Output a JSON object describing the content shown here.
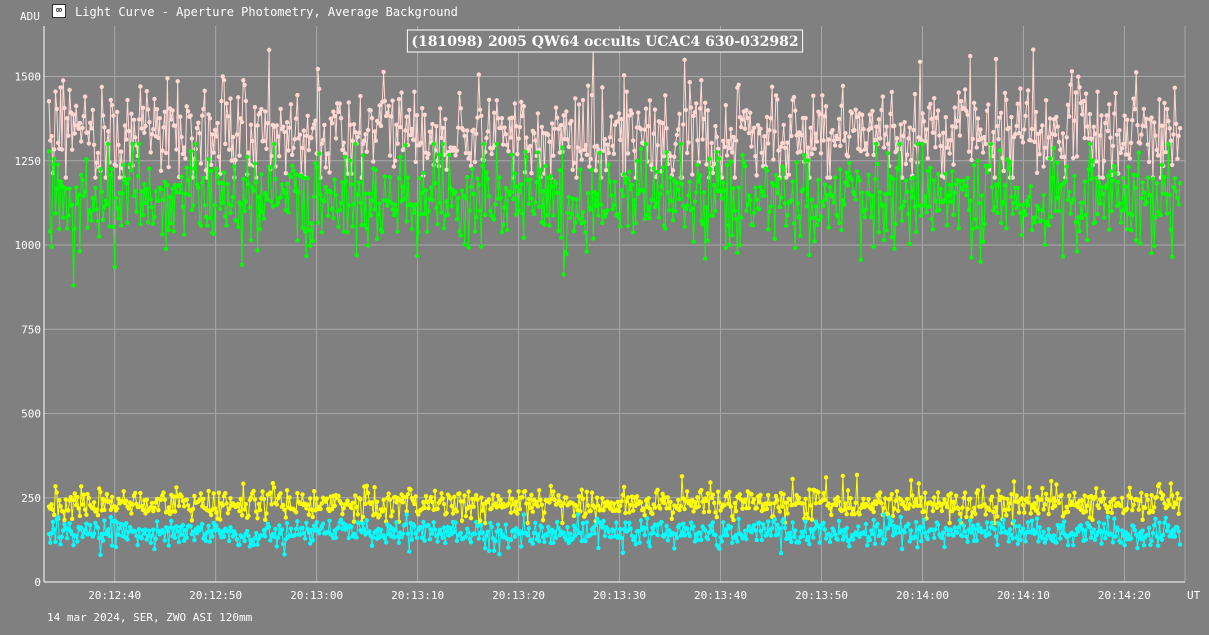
{
  "window": {
    "title": "Light Curve - Aperture Photometry, Average Background",
    "icon": "light-curve-app-icon"
  },
  "footer": {
    "text": "14 mar 2024, SER, ZWO ASI 120mm"
  },
  "colors": {
    "background": "#808080",
    "grid": "#a8a8a8",
    "target": "#00ff00",
    "comparison": "#ffd8d4",
    "background_target": "#ffff00",
    "background_comparison": "#00ffff"
  },
  "chart_data": {
    "type": "scatter",
    "title": "(181098) 2005 QW64 occults UCAC4 630-032982",
    "xlabel": "UT",
    "ylabel": "ADU",
    "xlim": [
      "20:12:33",
      "20:14:26"
    ],
    "ylim": [
      0,
      1650
    ],
    "yticks": [
      0,
      250,
      500,
      750,
      1000,
      1250,
      1500
    ],
    "ytick_labels": [
      "0",
      "250",
      "500",
      "750",
      "1000",
      "1250",
      "1500"
    ],
    "xticks": [
      "20:12:40",
      "20:12:50",
      "20:13:00",
      "20:13:10",
      "20:13:20",
      "20:13:30",
      "20:13:40",
      "20:13:50",
      "20:14:00",
      "20:14:10",
      "20:14:20"
    ],
    "grid": true,
    "connected_markers": true,
    "series": [
      {
        "color": "#ffd8d4",
        "mean": 1330,
        "spread": 75,
        "min": 1200,
        "max": 1580
      },
      {
        "color": "#00ff00",
        "mean": 1130,
        "spread": 70,
        "min": 880,
        "max": 1300
      },
      {
        "color": "#ffff00",
        "mean": 232,
        "spread": 22,
        "min": 175,
        "max": 330
      },
      {
        "color": "#00ffff",
        "mean": 145,
        "spread": 20,
        "min": 75,
        "max": 200
      }
    ]
  }
}
